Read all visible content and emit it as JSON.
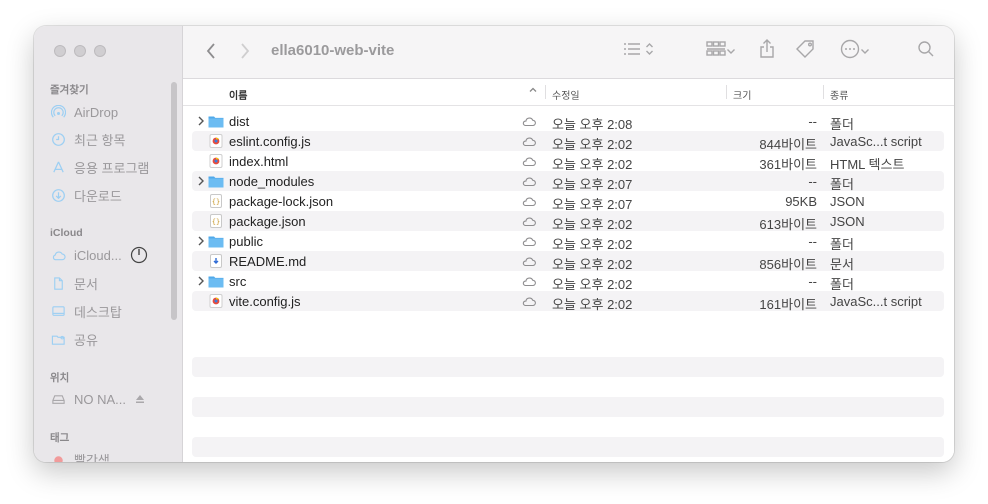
{
  "window": {
    "title": "ella6010-web-vite"
  },
  "sidebar": {
    "sections": [
      {
        "header": "즐겨찾기",
        "items": [
          {
            "label": "AirDrop",
            "icon": "airdrop-icon"
          },
          {
            "label": "최근 항목",
            "icon": "clock-icon"
          },
          {
            "label": "응용 프로그램",
            "icon": "applications-icon"
          },
          {
            "label": "다운로드",
            "icon": "download-icon"
          }
        ]
      },
      {
        "header": "iCloud",
        "items": [
          {
            "label": "iCloud...",
            "icon": "cloud-icon"
          },
          {
            "label": "문서",
            "icon": "document-icon"
          },
          {
            "label": "데스크탑",
            "icon": "desktop-icon"
          },
          {
            "label": "공유",
            "icon": "shared-folder-icon"
          }
        ]
      },
      {
        "header": "위치",
        "items": [
          {
            "label": "NO NA...",
            "icon": "drive-icon"
          }
        ]
      },
      {
        "header": "태그",
        "items": [
          {
            "label": "빨간색",
            "icon": "tag-red-icon",
            "color": "#ef4b4b"
          }
        ]
      }
    ]
  },
  "columns": {
    "name": "이름",
    "date": "수정일",
    "size": "크기",
    "kind": "종류"
  },
  "files": [
    {
      "name": "dist",
      "type": "folder",
      "date": "오늘 오후 2:08",
      "size": "--",
      "kind": "폴더"
    },
    {
      "name": "eslint.config.js",
      "type": "js",
      "date": "오늘 오후 2:02",
      "size": "844바이트",
      "kind": "JavaSc...t script"
    },
    {
      "name": "index.html",
      "type": "html",
      "date": "오늘 오후 2:02",
      "size": "361바이트",
      "kind": "HTML 텍스트"
    },
    {
      "name": "node_modules",
      "type": "folder",
      "date": "오늘 오후 2:07",
      "size": "--",
      "kind": "폴더"
    },
    {
      "name": "package-lock.json",
      "type": "json",
      "date": "오늘 오후 2:07",
      "size": "95KB",
      "kind": "JSON"
    },
    {
      "name": "package.json",
      "type": "json",
      "date": "오늘 오후 2:02",
      "size": "613바이트",
      "kind": "JSON"
    },
    {
      "name": "public",
      "type": "folder",
      "date": "오늘 오후 2:02",
      "size": "--",
      "kind": "폴더"
    },
    {
      "name": "README.md",
      "type": "md",
      "date": "오늘 오후 2:02",
      "size": "856바이트",
      "kind": "문서"
    },
    {
      "name": "src",
      "type": "folder",
      "date": "오늘 오후 2:02",
      "size": "--",
      "kind": "폴더"
    },
    {
      "name": "vite.config.js",
      "type": "js",
      "date": "오늘 오후 2:02",
      "size": "161바이트",
      "kind": "JavaSc...t script"
    }
  ],
  "colors": {
    "folder": "#4fa9ea",
    "sidebar_bg": "#e9e7ea"
  }
}
